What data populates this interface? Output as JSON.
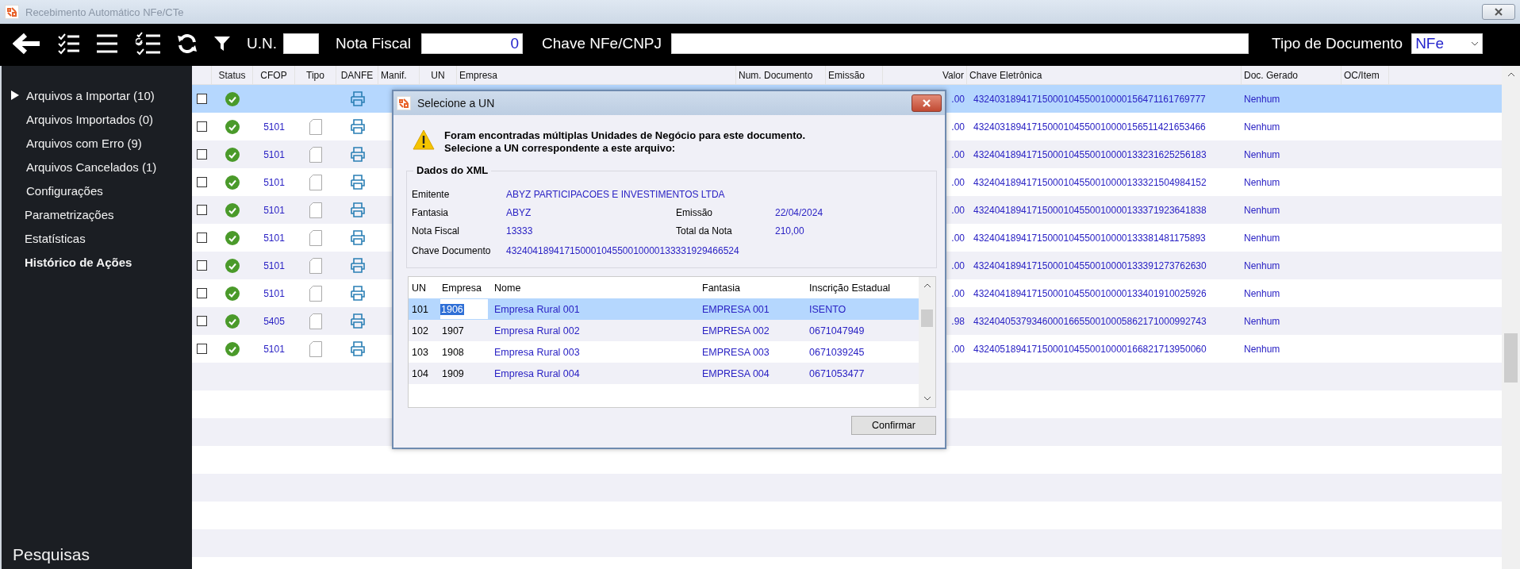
{
  "window": {
    "title": "Recebimento Automático NFe/CTe"
  },
  "toolbar": {
    "un": {
      "label": "U.N."
    },
    "nota_fiscal": {
      "label": "Nota Fiscal",
      "value": "0"
    },
    "chave": {
      "label": "Chave NFe/CNPJ"
    },
    "tipo_documento": {
      "label": "Tipo de Documento",
      "value": "NFe"
    }
  },
  "sidebar": {
    "items": [
      {
        "label": "Arquivos a Importar (10)",
        "expanded": false,
        "selected": false
      },
      {
        "label": "Arquivos Importados (0)",
        "selected": false
      },
      {
        "label": "Arquivos com Erro (9)",
        "selected": false
      },
      {
        "label": "Arquivos Cancelados (1)",
        "selected": false
      },
      {
        "label": "Configurações",
        "selected": false
      },
      {
        "label": "Parametrizações",
        "selected": false
      },
      {
        "label": "Estatísticas",
        "selected": false
      },
      {
        "label": "Histórico de Ações",
        "selected": true
      }
    ],
    "footer": "Pesquisas"
  },
  "table": {
    "columns": [
      "Status",
      "CFOP",
      "Tipo",
      "DANFE",
      "Manif.",
      "UN",
      "Empresa",
      "Num. Documento",
      "Emissão",
      "Valor",
      "Chave Eletrônica",
      "Doc. Gerado",
      "OC/Item"
    ],
    "rows": [
      {
        "selected": true,
        "checked": false,
        "status_ok": true,
        "has_document": false,
        "valor": ".00",
        "chave": "43240318941715000104550010000156471161769777",
        "doc_gerado": "Nenhum"
      },
      {
        "selected": false,
        "checked": false,
        "status_ok": true,
        "has_document": true,
        "cfop": "5101",
        "valor": ".00",
        "chave": "43240318941715000104550010000156511421653466",
        "doc_gerado": "Nenhum"
      },
      {
        "selected": false,
        "checked": false,
        "status_ok": true,
        "has_document": true,
        "cfop": "5101",
        "valor": ".00",
        "chave": "43240418941715000104550010000133231625256183",
        "doc_gerado": "Nenhum"
      },
      {
        "selected": false,
        "checked": false,
        "status_ok": true,
        "has_document": true,
        "cfop": "5101",
        "valor": ".00",
        "chave": "43240418941715000104550010000133321504984152",
        "doc_gerado": "Nenhum"
      },
      {
        "selected": false,
        "checked": false,
        "status_ok": true,
        "has_document": true,
        "cfop": "5101",
        "valor": ".00",
        "chave": "43240418941715000104550010000133371923641838",
        "doc_gerado": "Nenhum"
      },
      {
        "selected": false,
        "checked": false,
        "status_ok": true,
        "has_document": true,
        "cfop": "5101",
        "valor": ".00",
        "chave": "43240418941715000104550010000133381481175893",
        "doc_gerado": "Nenhum"
      },
      {
        "selected": false,
        "checked": false,
        "status_ok": true,
        "has_document": true,
        "cfop": "5101",
        "valor": ".00",
        "chave": "43240418941715000104550010000133391273762630",
        "doc_gerado": "Nenhum"
      },
      {
        "selected": false,
        "checked": false,
        "status_ok": true,
        "has_document": true,
        "cfop": "5101",
        "valor": ".00",
        "chave": "43240418941715000104550010000133401910025926",
        "doc_gerado": "Nenhum"
      },
      {
        "selected": false,
        "checked": false,
        "status_ok": true,
        "has_document": true,
        "cfop": "5405",
        "valor": ".98",
        "chave": "43240405379346000166550010005862171000992743",
        "doc_gerado": "Nenhum"
      },
      {
        "selected": false,
        "checked": false,
        "status_ok": true,
        "has_document": true,
        "cfop": "5101",
        "valor": ".00",
        "chave": "43240518941715000104550010000166821713950060",
        "doc_gerado": "Nenhum"
      }
    ]
  },
  "dialog": {
    "title": "Selecione a UN",
    "message": "Foram encontradas múltiplas Unidades de Negócio para este documento.\nSelecione a UN correspondente a este arquivo:",
    "xml_group": {
      "title": "Dados do XML",
      "rows": [
        {
          "fields": [
            {
              "label": "Emitente",
              "value": "ABYZ PARTICIPACOES E INVESTIMENTOS LTDA"
            }
          ]
        },
        {
          "fields": [
            {
              "label": "Fantasia",
              "value": "ABYZ"
            },
            {
              "label": "Emissão",
              "value": "22/04/2024"
            }
          ]
        },
        {
          "fields": [
            {
              "label": "Nota Fiscal",
              "value": "13333"
            },
            {
              "label": "Total da Nota",
              "value": "210,00"
            }
          ]
        },
        {
          "fields": [
            {
              "label": "Chave Documento",
              "value": "43240418941715000104550010000133331929466524"
            }
          ]
        }
      ]
    },
    "grid": {
      "columns": [
        "UN",
        "Empresa",
        "Nome",
        "Fantasia",
        "Inscrição Estadual"
      ],
      "rows": [
        {
          "selected": true,
          "editing": true,
          "cells": [
            "101",
            "1906",
            "Empresa Rural 001",
            "EMPRESA 001",
            "ISENTO"
          ]
        },
        {
          "selected": false,
          "editing": false,
          "cells": [
            "102",
            "1907",
            "Empresa Rural 002",
            "EMPRESA 002",
            "0671047949"
          ]
        },
        {
          "selected": false,
          "editing": false,
          "cells": [
            "103",
            "1908",
            "Empresa Rural 003",
            "EMPRESA 003",
            "0671039245"
          ]
        },
        {
          "selected": false,
          "editing": false,
          "cells": [
            "104",
            "1909",
            "Empresa Rural 004",
            "EMPRESA 004",
            "0671053477"
          ]
        }
      ]
    },
    "confirm_button": "Confirmar"
  }
}
